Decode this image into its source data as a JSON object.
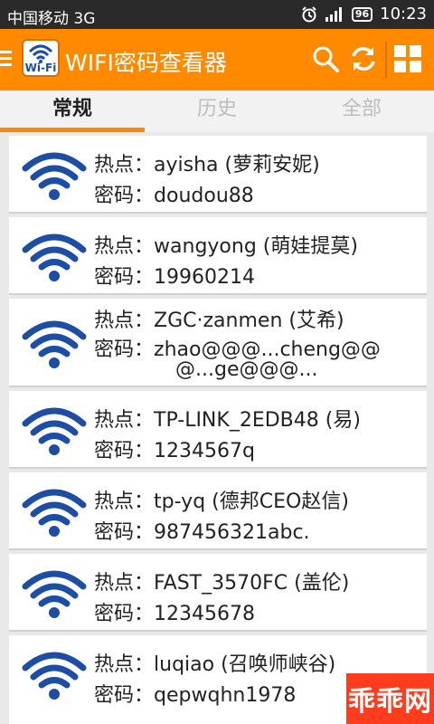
{
  "status_bar": {
    "carrier": "中国移动 3G",
    "battery": "96",
    "time": "10:23"
  },
  "app": {
    "title": "WIFI密码查看器",
    "logo_text": "Wi-Fi"
  },
  "tabs": [
    {
      "label": "常规",
      "active": true
    },
    {
      "label": "历史",
      "active": false
    },
    {
      "label": "全部",
      "active": false
    }
  ],
  "labels": {
    "hotspot": "热点",
    "password": "密码",
    "sep": "："
  },
  "networks": [
    {
      "hotspot": "ayisha (萝莉安妮)",
      "password": "doudou88"
    },
    {
      "hotspot": "wangyong (萌娃提莫)",
      "password": "19960214"
    },
    {
      "hotspot": "ZGC·zanmen (艾希)",
      "password": "zhao@@@...cheng@@",
      "password_cont": "@...ge@@@..."
    },
    {
      "hotspot": "TP-LINK_2EDB48 (易)",
      "password": "1234567q"
    },
    {
      "hotspot": "tp-yq (德邦CEO赵信)",
      "password": "987456321abc."
    },
    {
      "hotspot": "FAST_3570FC (盖伦)",
      "password": "12345678"
    },
    {
      "hotspot": "luqiao (召唤师峡谷)",
      "password": "qepwqhn1978"
    }
  ],
  "watermark": "乖乖网",
  "colors": {
    "accent": "#ff8a00",
    "wifi_blue": "#1a4da8",
    "watermark": "#ff3d1e"
  }
}
